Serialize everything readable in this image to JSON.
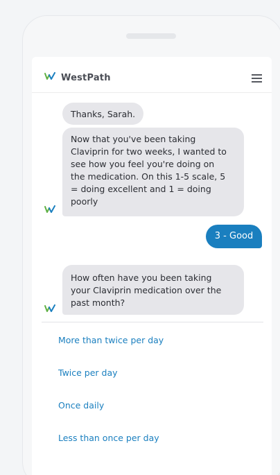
{
  "header": {
    "brand": "WestPath",
    "menu_icon": "hamburger-menu-icon",
    "logo_icon": "westpath-logo-icon"
  },
  "colors": {
    "accent": "#1a7fbf",
    "bot_bubble": "#e6e6ea",
    "logo_green": "#5fb043",
    "logo_blue": "#1a7fbf"
  },
  "chat": {
    "messages": [
      {
        "sender": "bot",
        "text": "Thanks, Sarah."
      },
      {
        "sender": "bot",
        "text": "Now that you've been taking\nClaviprin for two weeks, I wanted to\nsee how you feel you're doing on\nthe medication. On this 1-5 scale, 5\n= doing excellent and 1 = doing\npoorly"
      },
      {
        "sender": "user",
        "text": "3 - Good"
      },
      {
        "sender": "bot",
        "text": "How often have you been taking\nyour Claviprin medication over the\npast month?"
      }
    ]
  },
  "options": [
    "More than twice per day",
    "Twice per day",
    "Once daily",
    "Less than once per day"
  ]
}
